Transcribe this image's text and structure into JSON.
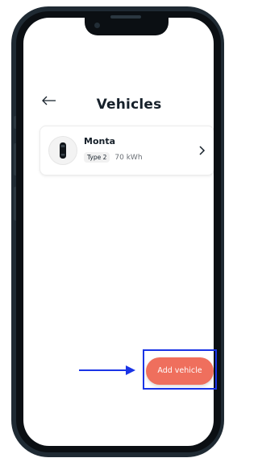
{
  "header": {
    "back_icon": "arrow-left-icon",
    "title": "Vehicles"
  },
  "vehicle": {
    "name": "Monta",
    "connector": "Type 2",
    "battery": "70 kWh",
    "avatar_icon": "car-top-view-icon",
    "chevron_icon": "chevron-right-icon"
  },
  "actions": {
    "add_vehicle_label": "Add vehicle"
  },
  "colors": {
    "accent": "#ef6f5d",
    "annotation": "#1a34e6",
    "title_text": "#16202a",
    "frame": "#1f2a33"
  }
}
